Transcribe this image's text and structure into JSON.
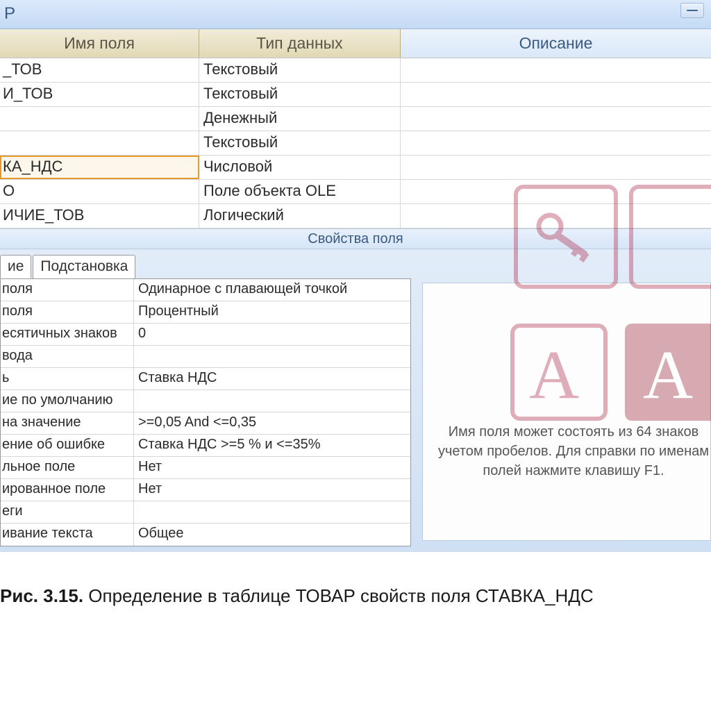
{
  "titlebar": {
    "text": "Р",
    "min": "–"
  },
  "columns": {
    "name": "Имя поля",
    "type": "Тип данных",
    "desc": "Описание"
  },
  "rows": [
    {
      "name": "_ТОВ",
      "type": "Текстовый",
      "desc": ""
    },
    {
      "name": "И_ТОВ",
      "type": "Текстовый",
      "desc": ""
    },
    {
      "name": "",
      "type": "Денежный",
      "desc": ""
    },
    {
      "name": "",
      "type": "Текстовый",
      "desc": ""
    },
    {
      "name": "КА_НДС",
      "type": "Числовой",
      "desc": "",
      "selected": true
    },
    {
      "name": "О",
      "type": "Поле объекта OLE",
      "desc": ""
    },
    {
      "name": "ИЧИЕ_ТОВ",
      "type": "Логический",
      "desc": ""
    }
  ],
  "section_sep": "Свойства поля",
  "tabs": {
    "general": "ие",
    "lookup": "Подстановка"
  },
  "props": [
    {
      "label": "поля",
      "value": "Одинарное с плавающей точкой"
    },
    {
      "label": "поля",
      "value": "Процентный"
    },
    {
      "label": "есятичных знаков",
      "value": "0"
    },
    {
      "label": "вода",
      "value": ""
    },
    {
      "label": "ь",
      "value": "Ставка НДС"
    },
    {
      "label": "ие по умолчанию",
      "value": ""
    },
    {
      "label": " на значение",
      "value": ">=0,05 And <=0,35"
    },
    {
      "label": "ение об ошибке",
      "value": "Ставка НДС >=5 % и <=35%"
    },
    {
      "label": "льное поле",
      "value": "Нет"
    },
    {
      "label": "ированное поле",
      "value": "Нет"
    },
    {
      "label": "еги",
      "value": ""
    },
    {
      "label": "ивание текста",
      "value": "Общее"
    }
  ],
  "help": "Имя поля может состоять из 64 знаков учетом пробелов.  Для справки по именам полей нажмите клавишу F1.",
  "caption_bold": "Рис. 3.15.",
  "caption_rest": " Определение в таблице ТОВАР свойств поля СТАВКА_НДС"
}
